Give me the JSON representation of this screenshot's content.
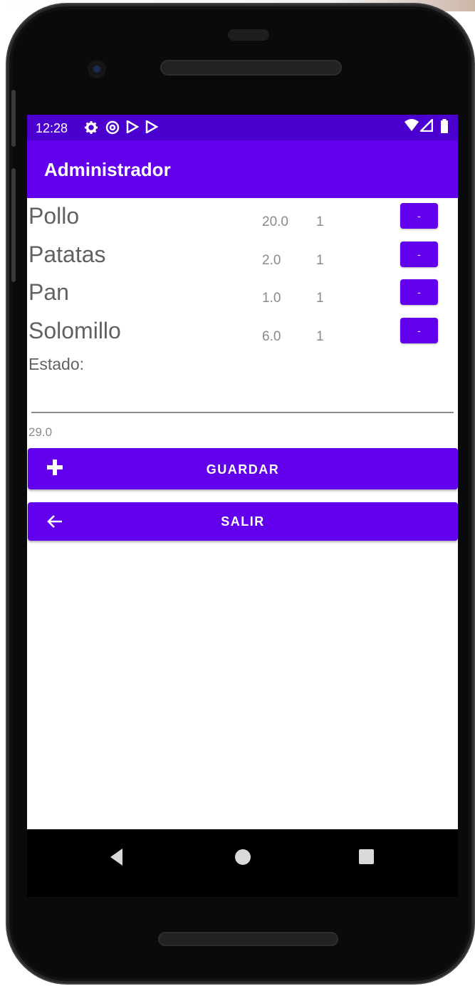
{
  "status_bar": {
    "time": "12:28",
    "icons": [
      "settings-icon",
      "at-sign-icon",
      "play-store-icon",
      "play-store-icon"
    ],
    "right_icons": [
      "wifi-icon",
      "signal-icon",
      "battery-icon"
    ]
  },
  "app_bar": {
    "title": "Administrador"
  },
  "items": [
    {
      "name": "Pollo",
      "price": "20.0",
      "qty": "1",
      "button_label": "-"
    },
    {
      "name": "Patatas",
      "price": "2.0",
      "qty": "1",
      "button_label": "-"
    },
    {
      "name": "Pan",
      "price": "1.0",
      "qty": "1",
      "button_label": "-"
    },
    {
      "name": "Solomillo",
      "price": "6.0",
      "qty": "1",
      "button_label": "-"
    }
  ],
  "estado": {
    "label": "Estado:",
    "value": ""
  },
  "total": "29.0",
  "buttons": {
    "guardar": {
      "label": "GUARDAR",
      "icon": "plus-icon"
    },
    "salir": {
      "label": "SALIR",
      "icon": "arrow-left-icon"
    }
  },
  "colors": {
    "primary": "#6200ee",
    "primary_dark": "#4b00cf",
    "text_secondary": "#616161"
  }
}
